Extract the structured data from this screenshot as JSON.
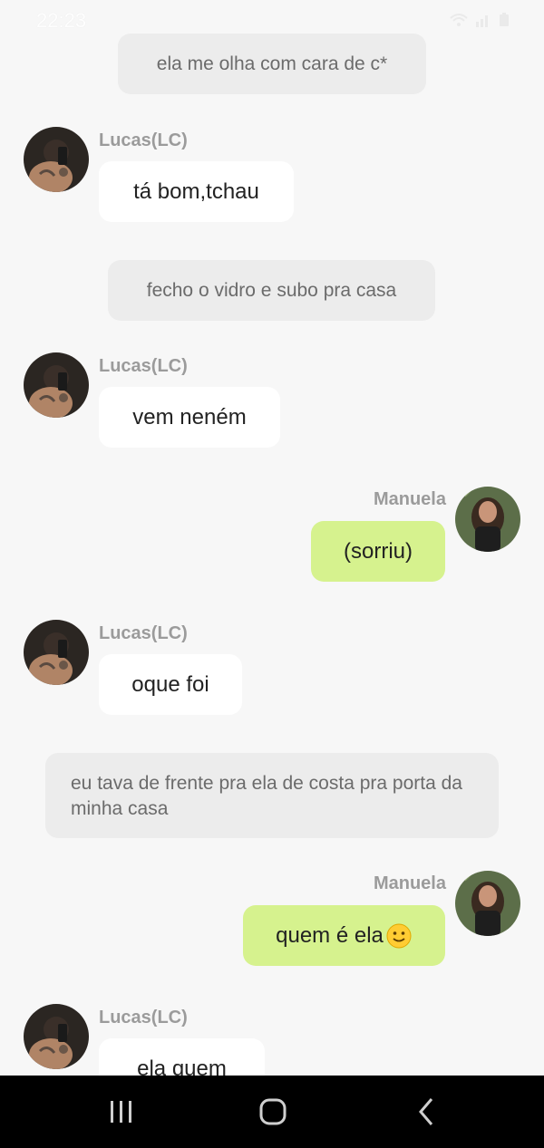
{
  "status_bar": {
    "time": "22:23",
    "icons": [
      "wifi-icon",
      "signal-icon",
      "battery-icon"
    ]
  },
  "messages": [
    {
      "kind": "narration",
      "text": "ela me olha com cara de c*"
    },
    {
      "kind": "left",
      "sender": "Lucas(LC)",
      "text": "tá bom,tchau"
    },
    {
      "kind": "narration",
      "text": "fecho o vidro e subo pra casa"
    },
    {
      "kind": "left",
      "sender": "Lucas(LC)",
      "text": "vem neném"
    },
    {
      "kind": "right",
      "sender": "Manuela",
      "text": "(sorriu)"
    },
    {
      "kind": "left",
      "sender": "Lucas(LC)",
      "text": "oque foi"
    },
    {
      "kind": "narration",
      "text": "eu tava de frente pra ela de costa pra porta da minha casa"
    },
    {
      "kind": "right",
      "sender": "Manuela",
      "text": "quem é ela",
      "emoji": "smiley-emoji-icon"
    },
    {
      "kind": "left",
      "sender": "Lucas(LC)",
      "text": "ela quem"
    }
  ],
  "colors": {
    "background": "#f7f7f7",
    "narration_bg": "#ececec",
    "left_bubble": "#ffffff",
    "right_bubble": "#d6f28e",
    "sender_name": "#9b9b9b",
    "nav_bar": "#000000"
  },
  "nav": {
    "icons": [
      "recent-apps-icon",
      "home-icon",
      "back-icon"
    ]
  }
}
